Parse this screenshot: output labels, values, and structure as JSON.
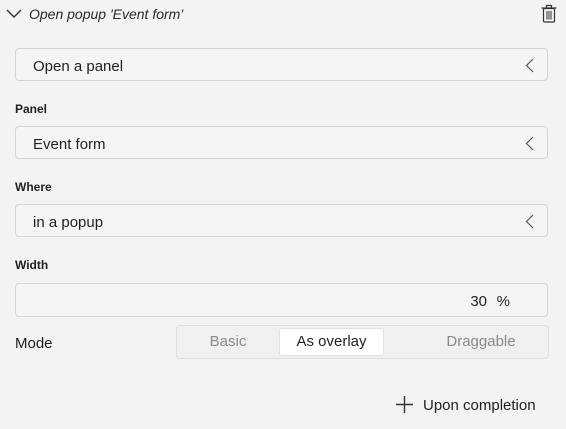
{
  "header": {
    "title": "Open popup 'Event form'",
    "collapse_icon": "chevron-down-icon",
    "delete_icon": "trash-icon"
  },
  "action": {
    "value": "Open a panel"
  },
  "panel": {
    "label": "Panel",
    "value": "Event form"
  },
  "where": {
    "label": "Where",
    "value": "in a popup"
  },
  "width": {
    "label": "Width",
    "value": "30",
    "unit": "%"
  },
  "mode": {
    "label": "Mode",
    "options": [
      "Basic",
      "As overlay",
      "Draggable"
    ],
    "selected": "As overlay"
  },
  "footer": {
    "add_label": "Upon completion",
    "add_icon": "plus-icon"
  },
  "colors": {
    "background": "#f3f3f3",
    "field_bg": "#f5f5f5",
    "border": "#d4d4d4",
    "selected_segment_bg": "#ffffff",
    "muted_text": "#8a8a8a"
  }
}
